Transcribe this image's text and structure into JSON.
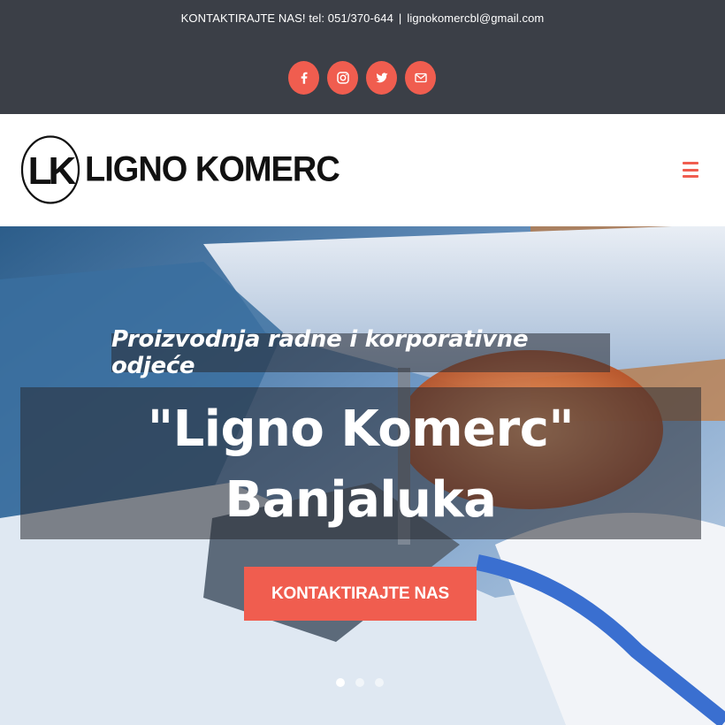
{
  "topbar": {
    "contact_label": "KONTAKTIRAJTE NAS! tel: 051/370-644",
    "separator": "|",
    "email": "lignokomercbl@gmail.com",
    "socials": [
      "facebook-icon",
      "instagram-icon",
      "twitter-icon",
      "mail-icon"
    ]
  },
  "header": {
    "logo_mark": "LK",
    "logo_text": "LIGNO KOMERC",
    "menu_icon": "hamburger-menu-icon"
  },
  "hero": {
    "tagline": "Proizvodnja radne i korporativne odjeće",
    "title_line1": "\"Ligno Komerc\"",
    "title_line2": "Banjaluka",
    "cta_label": "KONTAKTIRAJTE NAS",
    "slides_total": 3,
    "active_slide": 1
  },
  "colors": {
    "accent": "#f05d4f",
    "topbar_bg": "#3b3f47"
  }
}
